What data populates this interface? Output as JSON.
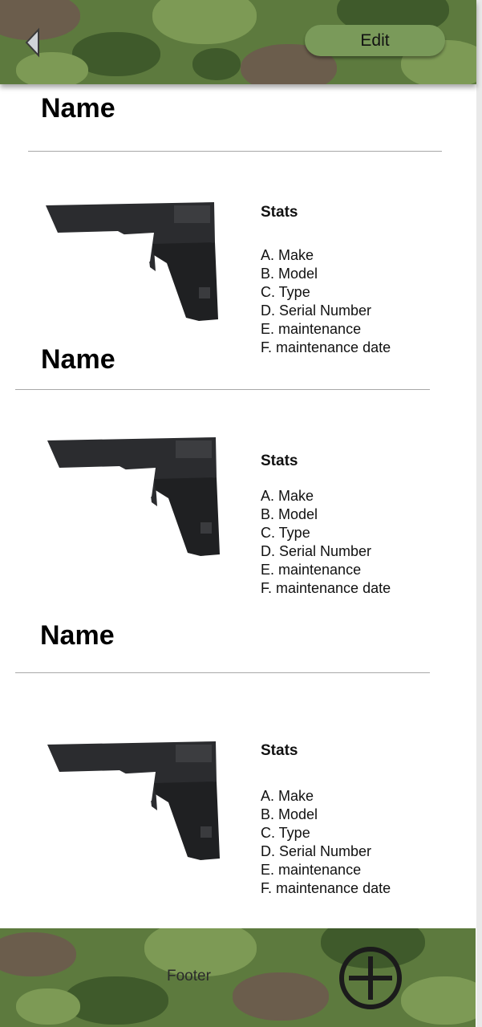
{
  "header": {
    "edit_label": "Edit",
    "back_icon": "chevron-left-icon"
  },
  "items": [
    {
      "name": "Name",
      "stats_title": "Stats",
      "stats": [
        "A. Make",
        "B. Model",
        "C. Type",
        "D. Serial Number",
        "E. maintenance",
        "F. maintenance date"
      ]
    },
    {
      "name": "Name",
      "stats_title": "Stats",
      "stats": [
        "A. Make",
        "B. Model",
        "C. Type",
        "D. Serial Number",
        "E. maintenance",
        "F. maintenance date"
      ]
    },
    {
      "name": "Name",
      "stats_title": "Stats",
      "stats": [
        "A. Make",
        "B. Model",
        "C. Type",
        "D. Serial Number",
        "E. maintenance",
        "F. maintenance date"
      ]
    }
  ],
  "footer": {
    "label": "Footer",
    "add_icon": "plus-circle-icon"
  },
  "colors": {
    "camo_base": "#5d7a3e",
    "edit_button": "#7a9a5a"
  }
}
